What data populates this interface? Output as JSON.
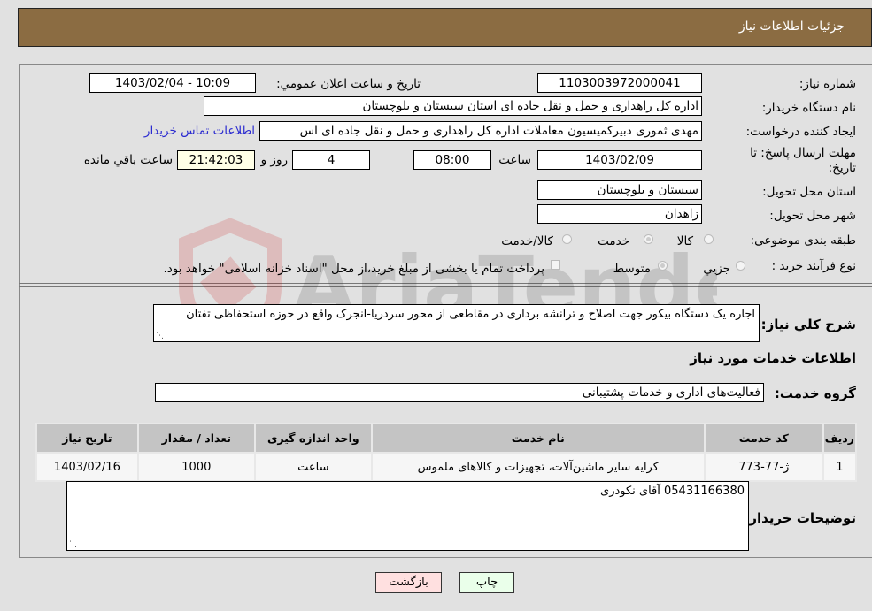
{
  "header": {
    "title": "جزئیات اطلاعات نیاز"
  },
  "fields": {
    "need_number": {
      "label": "شماره نیاز:",
      "value": "1103003972000041"
    },
    "announce_datetime": {
      "label": "تاریخ و ساعت اعلان عمومي:",
      "value": "1403/02/04 - 10:09"
    },
    "buyer_org": {
      "label": "نام دستگاه خریدار:",
      "value": "اداره کل راهداری و حمل و نقل جاده ای استان سیستان و بلوچستان"
    },
    "requester": {
      "label": "ایجاد کننده درخواست:",
      "value": "مهدی ثموری دبیرکمیسیون معاملات اداره کل راهداری و حمل و نقل جاده ای اس"
    },
    "buyer_contact_link": "اطلاعات تماس خریدار",
    "deadline": {
      "label": "مهلت ارسال پاسخ: تا تاریخ:",
      "date": "1403/02/09",
      "time_label": "ساعت",
      "time": "08:00",
      "days": "4",
      "days_label": "روز و",
      "remaining": "21:42:03",
      "remaining_label": "ساعت باقي مانده"
    },
    "delivery_province": {
      "label": "استان محل تحویل:",
      "value": "سیستان و بلوچستان"
    },
    "delivery_city": {
      "label": "شهر محل تحویل:",
      "value": "زاهدان"
    },
    "category": {
      "label": "طبقه بندی موضوعی:",
      "options": [
        "کالا",
        "خدمت",
        "کالا/خدمت"
      ],
      "selected": "خدمت"
    },
    "purchase_type": {
      "label": "نوع فرآیند خرید :",
      "options": [
        "جزيي",
        "متوسط"
      ],
      "selected": "متوسط",
      "treasury_note": "پرداخت تمام یا بخشی از مبلغ خرید،از محل \"اسناد خزانه اسلامی\" خواهد بود."
    }
  },
  "description": {
    "label": "شرح کلي نياز:",
    "value": "اجاره یک دستگاه بیکور جهت اصلاح و ترانشه برداری در مقاطعی از محور سردریا-انجرک واقع در حوزه استحفاظی تفتان"
  },
  "services_section": {
    "title": "اطلاعات خدمات مورد نیاز",
    "group_label": "گروه خدمت:",
    "group_value": "فعالیت‌های اداری و خدمات پشتیبانی"
  },
  "table": {
    "headers": [
      "ردیف",
      "کد خدمت",
      "نام خدمت",
      "واحد اندازه گیری",
      "تعداد / مقدار",
      "تاریخ نیاز"
    ],
    "rows": [
      [
        "1",
        "ژ-77-773",
        "کرایه سایر ماشین‌آلات، تجهیزات و کالاهای ملموس",
        "ساعت",
        "1000",
        "1403/02/16"
      ]
    ]
  },
  "buyer_notes": {
    "label": "توضیحات خریدار:",
    "value": "05431166380 آقای نکودری"
  },
  "buttons": {
    "print": "چاپ",
    "back": "بازگشت"
  },
  "watermark": {
    "text": "AriaTender.neT"
  },
  "colors": {
    "header_bg": "#8b6c42",
    "page_bg": "#e1e1e1",
    "link": "#2a2ad0",
    "print_bg": "#eaffea",
    "back_bg": "#ffe0e0"
  }
}
